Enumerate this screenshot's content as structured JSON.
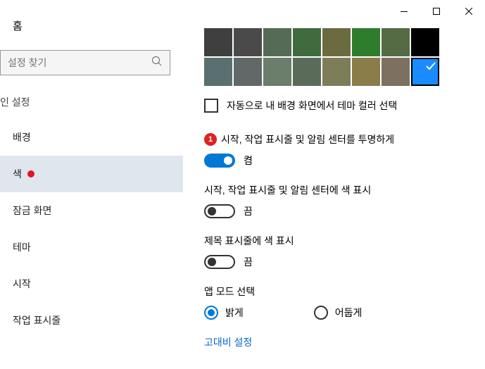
{
  "titlebar": {
    "minimize": "—",
    "maximize": "☐",
    "close": "✕"
  },
  "sidebar": {
    "home": "홈",
    "search_placeholder": "설정 찾기",
    "subheader": "인 설정",
    "items": [
      {
        "label": "배경"
      },
      {
        "label": "색"
      },
      {
        "label": "잠금 화면"
      },
      {
        "label": "테마"
      },
      {
        "label": "시작"
      },
      {
        "label": "작업 표시줄"
      }
    ]
  },
  "main": {
    "swatches_row1": [
      "#3f3f3f",
      "#4a4a4a",
      "#556b55",
      "#3f6b3f",
      "#6b6b3f",
      "#2d7d2d",
      "#556b44",
      "#000000"
    ],
    "swatches_row2": [
      "#5a7070",
      "#606868",
      "#6b7d6b",
      "#5a6b5a",
      "#7d7d5a",
      "#8a7d4a",
      "#7d7060",
      "#1a8cff"
    ],
    "auto_color_label": "자동으로 내 배경 화면에서 테마 컬러 선택",
    "marker1": "1",
    "transparency": {
      "label": "시작, 작업 표시줄 및 알림 센터를 투명하게",
      "state": "켬"
    },
    "show_color": {
      "label": "시작, 작업 표시줄 및 알림 센터에 색 표시",
      "state": "끔"
    },
    "title_bar_color": {
      "label": "제목 표시줄에 색 표시",
      "state": "끔"
    },
    "app_mode": {
      "label": "앱 모드 선택",
      "light": "밝게",
      "dark": "어둡게"
    },
    "high_contrast_link": "고대비 설정"
  }
}
